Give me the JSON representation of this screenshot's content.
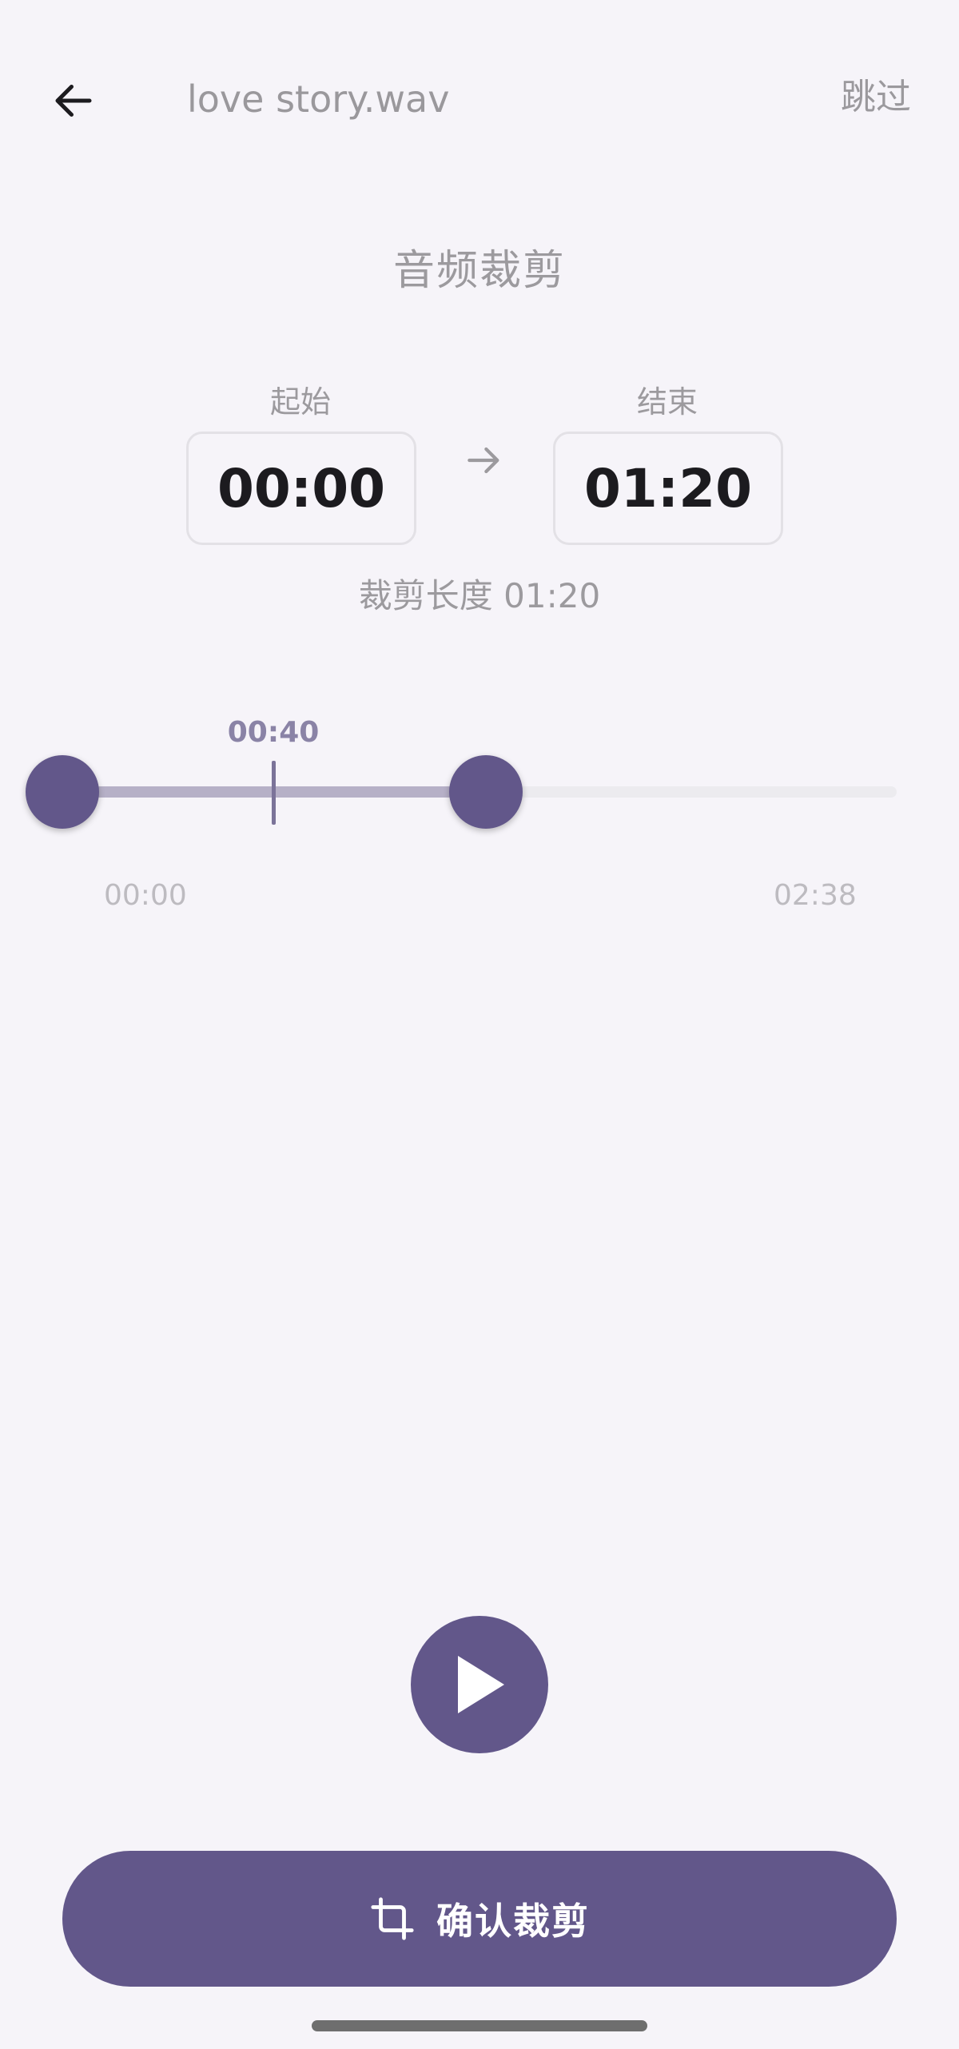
{
  "header": {
    "back_icon": "arrow-left-icon",
    "file_name": "love story.wav",
    "skip_label": "跳过"
  },
  "page_title": "音频裁剪",
  "trim": {
    "start_label": "起始",
    "start_time": "00:00",
    "end_label": "结束",
    "end_time": "01:20",
    "length_text": "裁剪长度 01:20"
  },
  "slider": {
    "playhead_time": "00:40",
    "range_min": "00:00",
    "range_max": "02:38",
    "start_fraction": 0.0,
    "end_fraction": 0.506,
    "playhead_fraction": 0.253
  },
  "play_icon": "play-icon",
  "confirm": {
    "icon": "crop-icon",
    "label": "确认裁剪"
  },
  "colors": {
    "accent": "#62578a",
    "background": "#f6f4f9",
    "selected_track": "#b6b0c7"
  }
}
